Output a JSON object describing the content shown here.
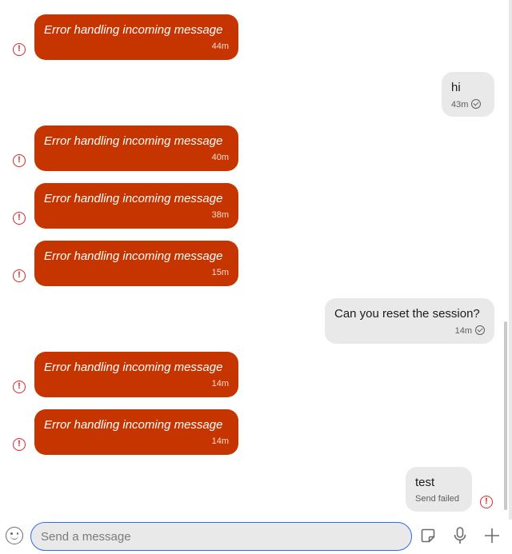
{
  "messages": [
    {
      "direction": "incoming",
      "text": "Error handling incoming message",
      "time": "44m"
    },
    {
      "direction": "outgoing",
      "text": "hi",
      "time": "43m",
      "status": "check-circle-icon"
    },
    {
      "direction": "incoming",
      "text": "Error handling incoming message",
      "time": "40m"
    },
    {
      "direction": "incoming",
      "text": "Error handling incoming message",
      "time": "38m"
    },
    {
      "direction": "incoming",
      "text": "Error handling incoming message",
      "time": "15m"
    },
    {
      "direction": "outgoing",
      "text": "Can you reset the session?",
      "time": "14m",
      "status": "check-circle-icon"
    },
    {
      "direction": "incoming",
      "text": "Error handling incoming message",
      "time": "14m"
    },
    {
      "direction": "incoming",
      "text": "Error handling incoming message",
      "time": "14m"
    },
    {
      "direction": "outgoing",
      "text": "test",
      "time": "Send failed",
      "status": "error-icon"
    }
  ],
  "composer": {
    "placeholder": "Send a message",
    "icons": [
      "emoji-icon",
      "sticker-icon",
      "microphone-icon",
      "plus-icon"
    ]
  },
  "colors": {
    "error_bubble": "#c63500",
    "outgoing_bubble": "#e9e9e9",
    "error_icon": "#d6292b",
    "input_focus": "#2c6bed"
  }
}
